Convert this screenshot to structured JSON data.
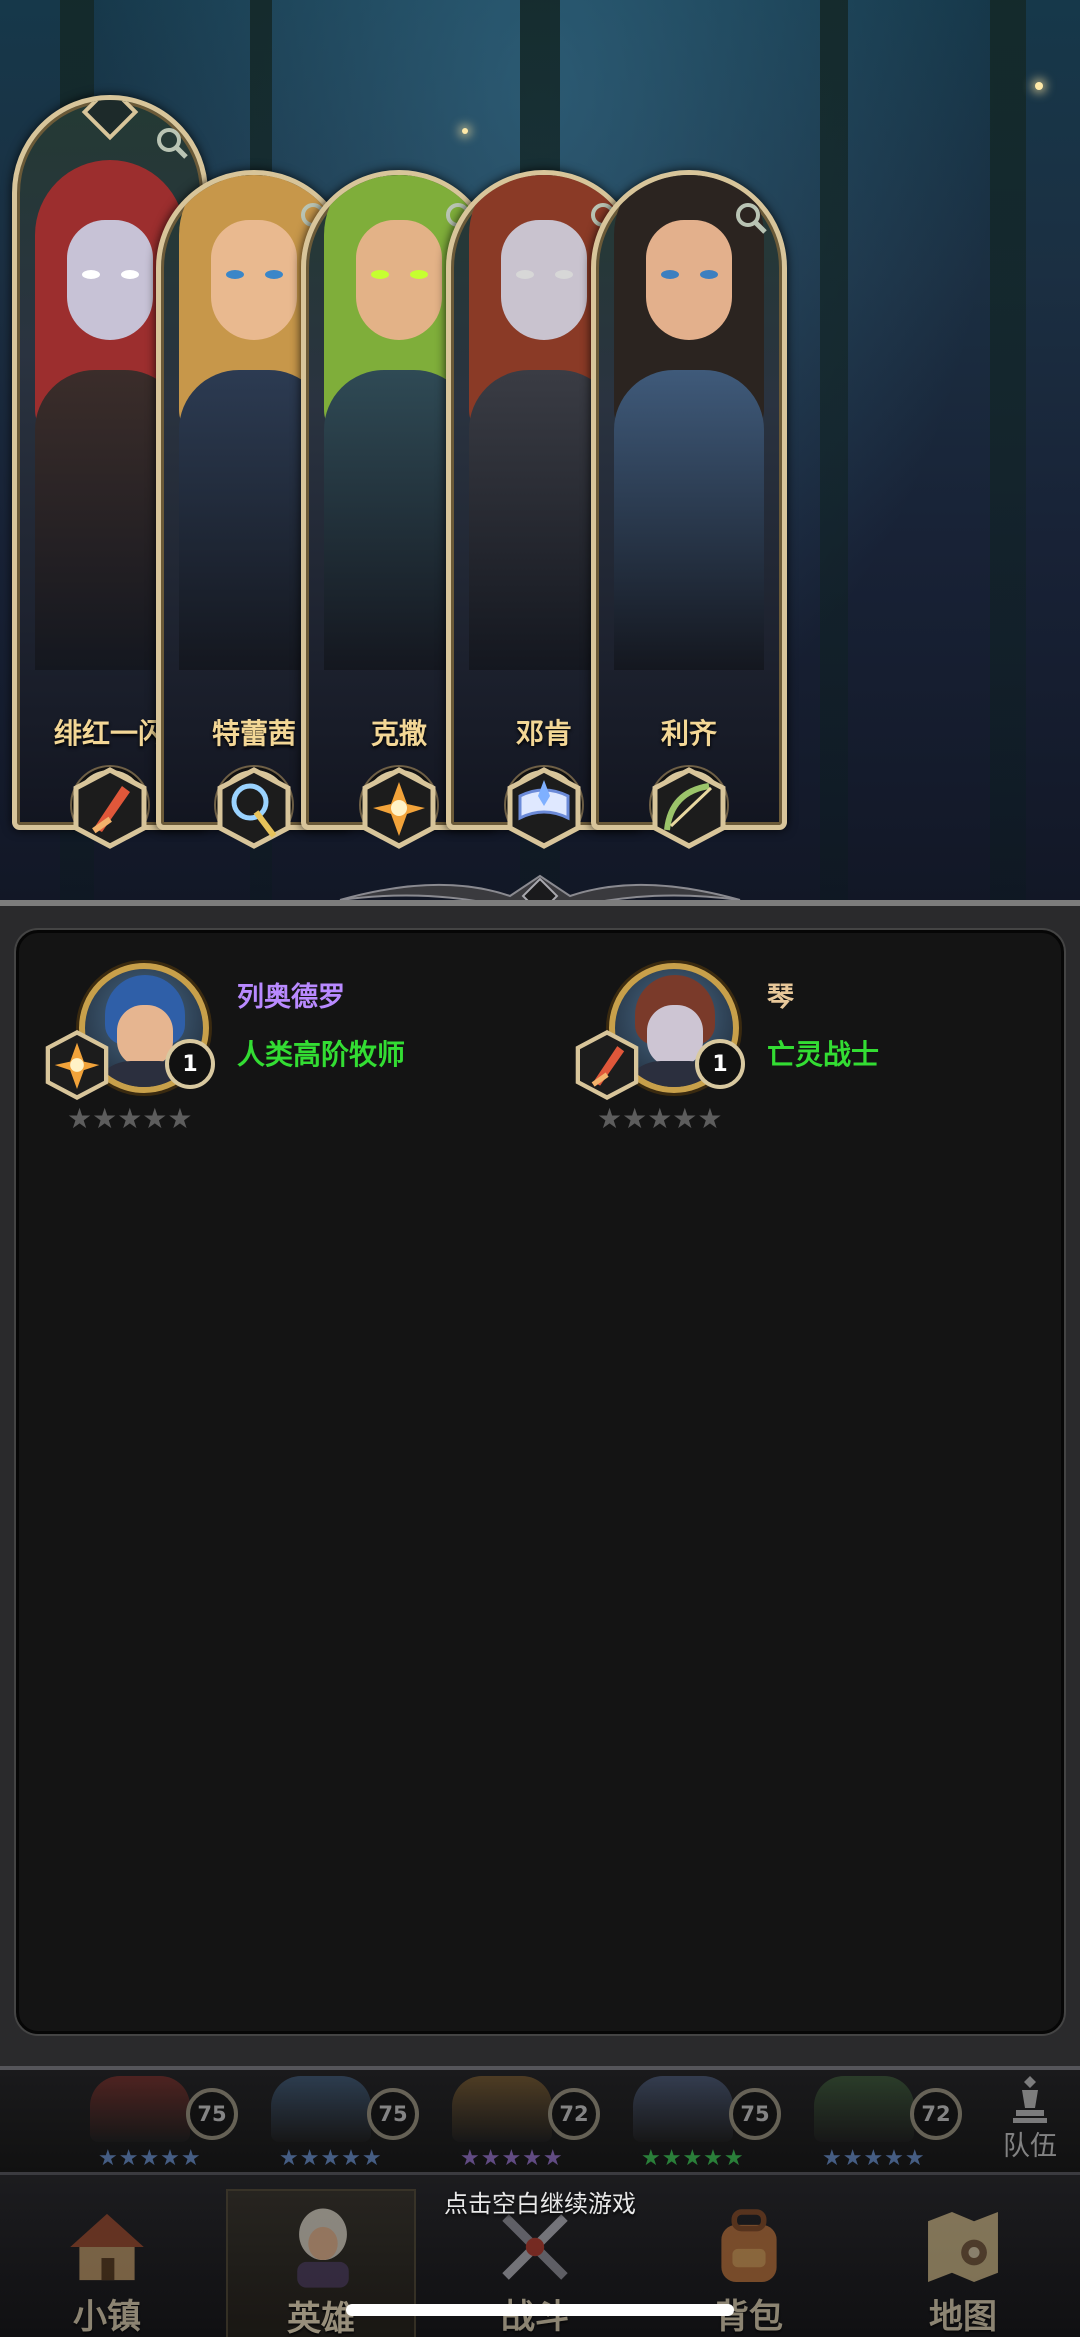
{
  "heroes": [
    {
      "name": "绯红一闪",
      "level": "75",
      "class_icon": "sword-class-icon",
      "hair": "#9c2e2e",
      "skin": "#c7c2d6",
      "body": "#3b2d2a",
      "eye": "#ffffff"
    },
    {
      "name": "特蕾茜",
      "level": "75",
      "class_icon": "orb-staff-class-icon",
      "hair": "#c7974a",
      "skin": "#e9b98f",
      "body": "#2c3b52",
      "eye": "#3a86c8"
    },
    {
      "name": "克撒",
      "level": "72",
      "class_icon": "holy-star-class-icon",
      "hair": "#7fae3a",
      "skin": "#e3b287",
      "body": "#2f4a55",
      "eye": "#c6ff30"
    },
    {
      "name": "邓肯",
      "level": "75",
      "class_icon": "spellbook-class-icon",
      "hair": "#8a3a26",
      "skin": "#c9c3cf",
      "body": "#3a3c44",
      "eye": "#d7d7d7"
    },
    {
      "name": "利齐",
      "level": "72",
      "class_icon": "bow-class-icon",
      "hair": "#2b2420",
      "skin": "#e3b08c",
      "body": "#3f5a7a",
      "eye": "#3c7fc0"
    }
  ],
  "roster": [
    {
      "name": "列奥德罗",
      "name_color": "#b98aff",
      "class_name": "人类高阶牧师",
      "level": "1",
      "class_icon": "holy-star-class-icon",
      "hair": "#2f5fa8",
      "skin": "#e6b590",
      "stars": "★★★★★"
    },
    {
      "name": "琴",
      "name_color": "#e8c89a",
      "class_name": "亡灵战士",
      "level": "1",
      "class_icon": "sword-class-icon",
      "hair": "#7a3a2a",
      "skin": "#cdc5d3",
      "stars": "★★★★★"
    }
  ],
  "lineup": [
    {
      "level": "75",
      "stars": "★★★★★",
      "star_color": "#6f9be0",
      "color": "#7a2c26"
    },
    {
      "level": "75",
      "stars": "★★★★★",
      "star_color": "#6f9be0",
      "color": "#3d5a7a"
    },
    {
      "level": "72",
      "stars": "★★★★★",
      "star_color": "#a37be0",
      "color": "#7a5a2c"
    },
    {
      "level": "75",
      "stars": "★★★★★",
      "star_color": "#3fd85a",
      "color": "#4a5a7a"
    },
    {
      "level": "72",
      "stars": "★★★★★",
      "star_color": "#6f9be0",
      "color": "#3a5a36"
    }
  ],
  "team_button": "队伍",
  "nav": [
    {
      "label": "小镇",
      "icon": "town-icon"
    },
    {
      "label": "英雄",
      "icon": "hero-icon"
    },
    {
      "label": "战斗",
      "icon": "battle-icon"
    },
    {
      "label": "背包",
      "icon": "backpack-icon"
    },
    {
      "label": "地图",
      "icon": "map-icon"
    }
  ],
  "hint": "点击空白继续游戏",
  "colors": {
    "gold": "#d8c59a",
    "panel": "#141414",
    "class_text": "#33dd33"
  }
}
